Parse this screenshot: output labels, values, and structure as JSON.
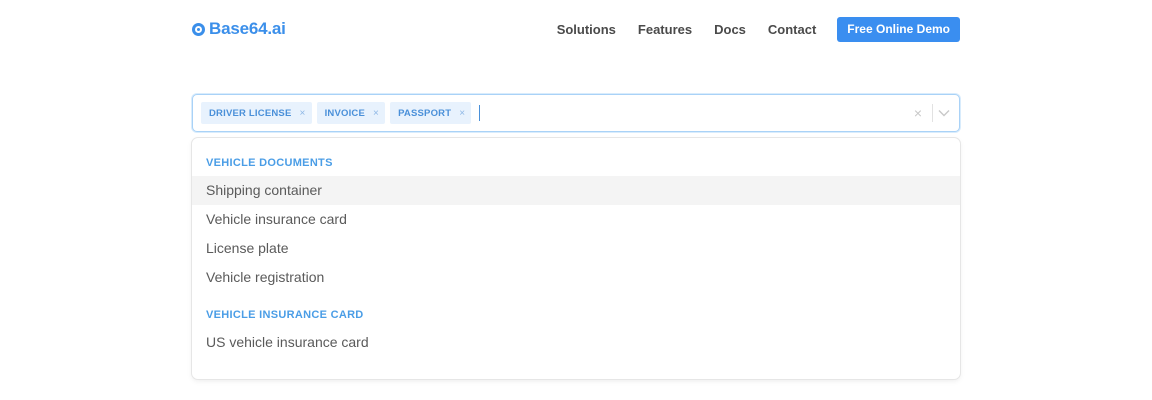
{
  "header": {
    "logo_text": "Base64.ai",
    "nav": [
      "Solutions",
      "Features",
      "Docs",
      "Contact"
    ],
    "cta_label": "Free Online Demo"
  },
  "select": {
    "tags": [
      {
        "label": "DRIVER LICENSE"
      },
      {
        "label": "INVOICE"
      },
      {
        "label": "PASSPORT"
      }
    ],
    "tag_remove_glyph": "×",
    "clear_glyph": "×"
  },
  "menu": {
    "groups": [
      {
        "heading": "VEHICLE DOCUMENTS",
        "options": [
          "Shipping container",
          "Vehicle insurance card",
          "License plate",
          "Vehicle registration"
        ]
      },
      {
        "heading": "VEHICLE INSURANCE CARD",
        "options": [
          "US vehicle insurance card"
        ]
      }
    ]
  },
  "colors": {
    "brand": "#3b8fea",
    "cta": "#3a8ef0",
    "tag_bg": "#e8f2fd",
    "heading": "#4a9de6"
  }
}
